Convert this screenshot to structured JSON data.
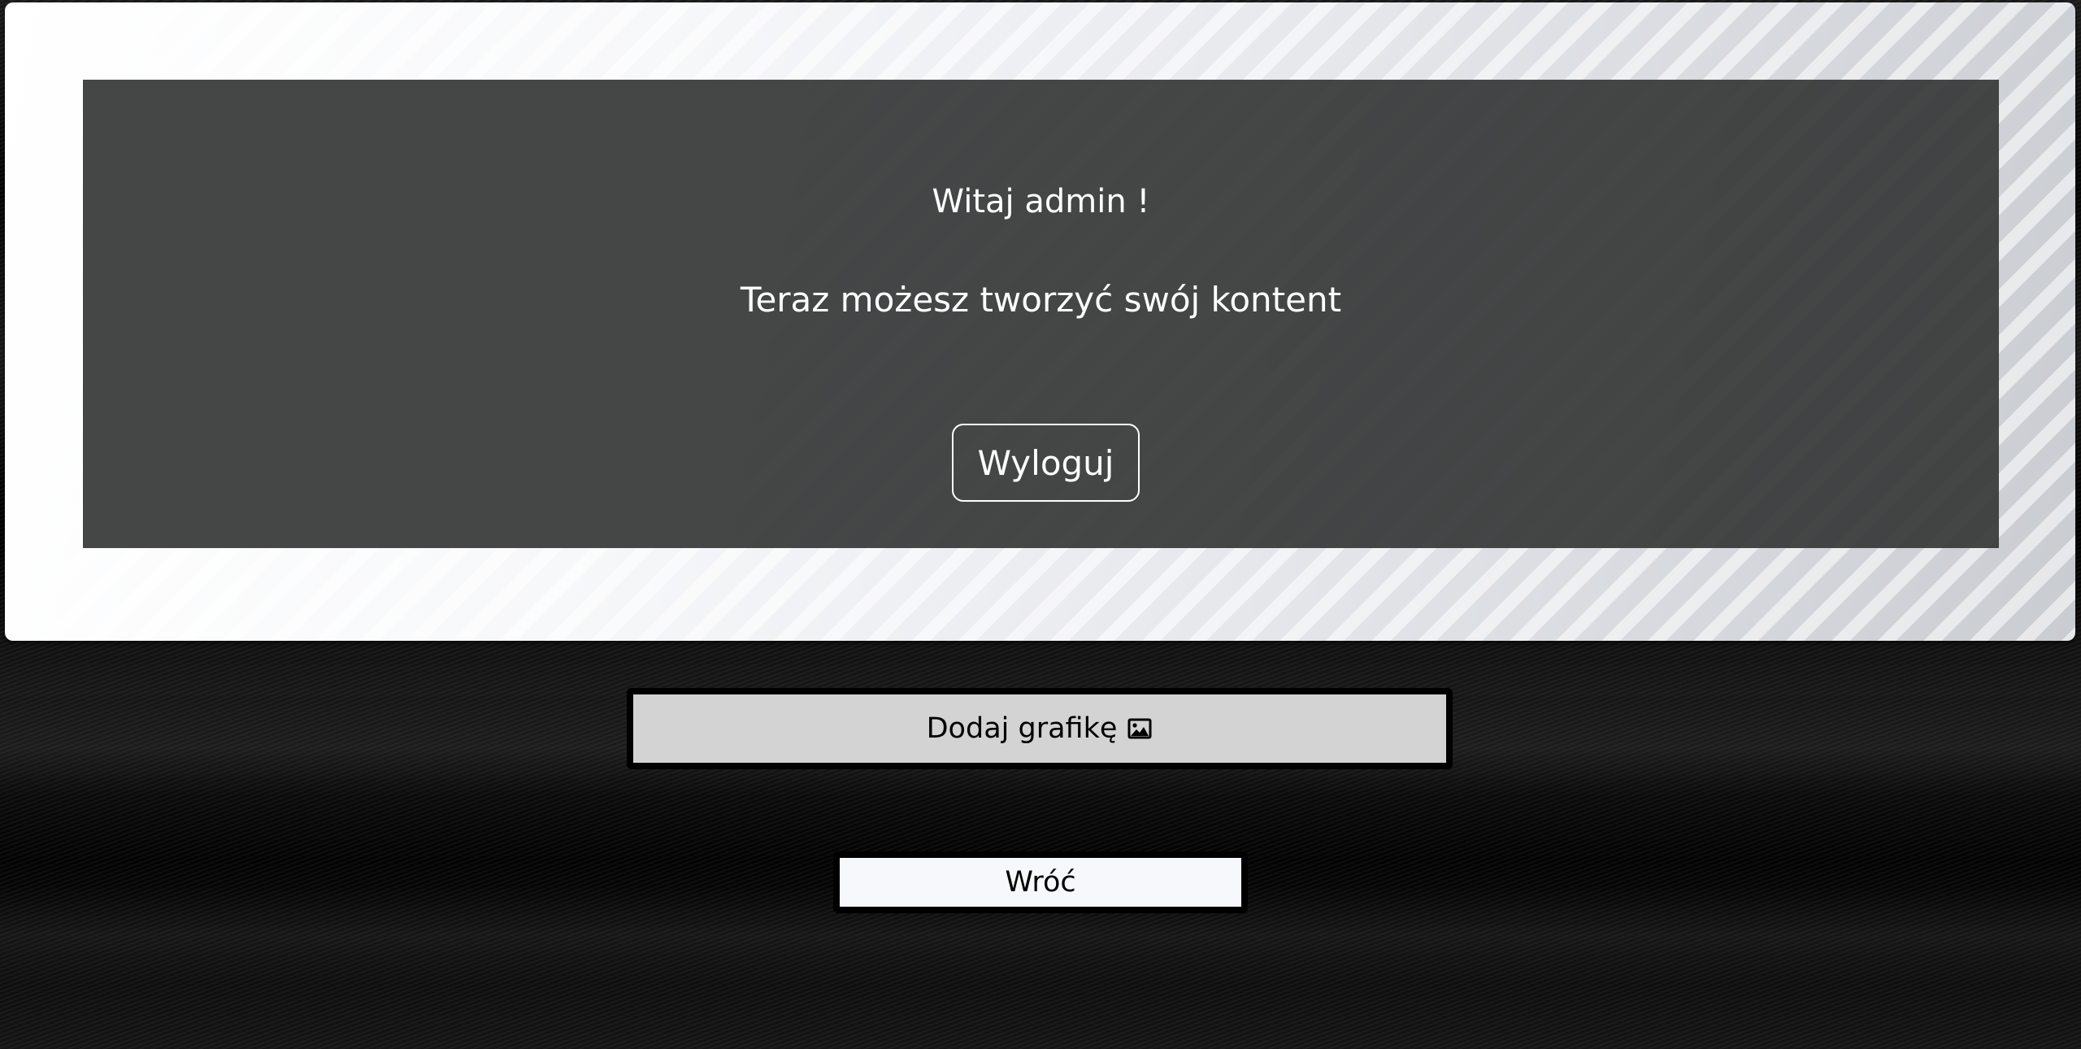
{
  "header": {
    "greeting": "Witaj admin !",
    "subtitle": "Teraz możesz tworzyć swój kontent",
    "logout_label": "Wyloguj"
  },
  "actions": {
    "add_graphic_label": "Dodaj grafikę",
    "add_graphic_icon": "image-icon",
    "back_label": "Wróć"
  },
  "colors": {
    "panel": "#373838",
    "page_background": "#0a0a0a",
    "add_button": "#d3d3d3",
    "back_button": "#f7f8fb"
  }
}
